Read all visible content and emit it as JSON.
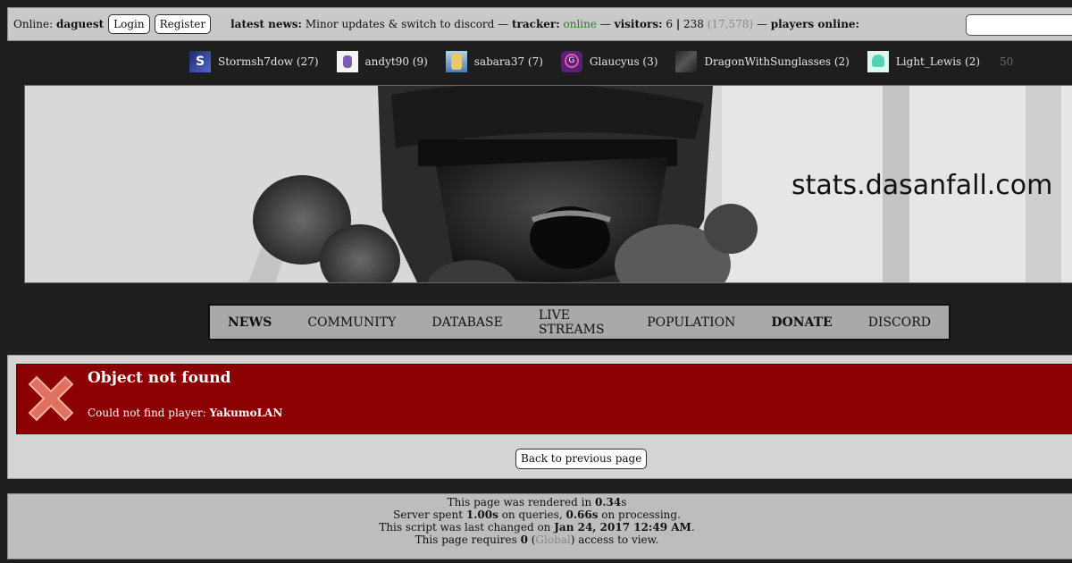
{
  "topbar": {
    "online_label": "Online:",
    "username": "daguest",
    "login_label": "Login",
    "register_label": "Register",
    "news_label": "latest news:",
    "news_text": "Minor updates & switch to discord",
    "sep1": "—",
    "tracker_label": "tracker:",
    "tracker_status": "online",
    "sep2": "—",
    "visitors_label": "visitors:",
    "visitors_now": "6",
    "visitors_today": "238",
    "visitors_total": "(17,578)",
    "sep3": "—",
    "players_label": "players online:"
  },
  "players": [
    {
      "name": "Stormsh7dow (27)",
      "icon": "stormsh7dow-avatar",
      "avatar_text": "S"
    },
    {
      "name": "andyt90 (9)",
      "icon": "andyt90-avatar"
    },
    {
      "name": "sabara37 (7)",
      "icon": "sabara37-avatar"
    },
    {
      "name": "Glaucyus (3)",
      "icon": "glaucyus-avatar"
    },
    {
      "name": "DragonWithSunglasses (2)",
      "icon": "dragon-avatar"
    },
    {
      "name": "Light_Lewis (2)",
      "icon": "light-lewis-avatar"
    }
  ],
  "players_count": "50",
  "banner": {
    "site_title": "stats.dasanfall.com"
  },
  "nav": [
    {
      "label": "NEWS",
      "bold": true
    },
    {
      "label": "COMMUNITY",
      "bold": false
    },
    {
      "label": "DATABASE",
      "bold": false
    },
    {
      "label": "LIVE STREAMS",
      "bold": false
    },
    {
      "label": "POPULATION",
      "bold": false
    },
    {
      "label": "DONATE",
      "bold": true
    },
    {
      "label": "DISCORD",
      "bold": false
    }
  ],
  "error": {
    "title": "Object not found",
    "message_prefix": "Could not find player:",
    "player": "YakumoLAN",
    "icon": "error-x-icon"
  },
  "back_button": "Back to previous page",
  "footer": {
    "line1_prefix": "This page was rendered in",
    "render_time": "0.34",
    "line1_suffix": "s",
    "line2_prefix": "Server spent",
    "query_time": "1.00s",
    "line2_mid": "on queries,",
    "proc_time": "0.66s",
    "line2_suffix": "on processing.",
    "line3_prefix": "This script was last changed on",
    "changed_date": "Jan 24, 2017 12:49 AM",
    "line3_suffix": ".",
    "line4_prefix": "This page requires",
    "access_level": "0",
    "access_scope": "Global",
    "line4_suffix": "access to view."
  },
  "colors": {
    "error_bg": "#8b0000",
    "error_icon": "#e07060",
    "tracker_online": "#2c7a2c",
    "page_bg": "#1e1e1e"
  }
}
